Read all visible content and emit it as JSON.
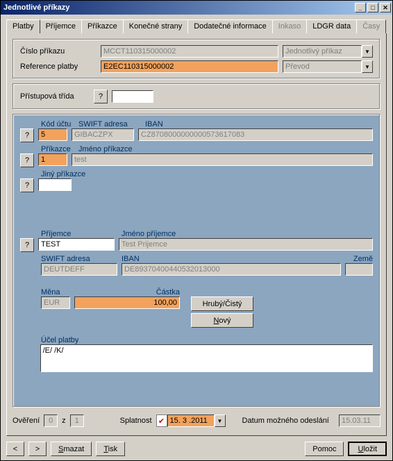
{
  "window": {
    "title": "Jednotlivé příkazy"
  },
  "tabs": {
    "platby": "Platby",
    "prijemce": "Příjemce",
    "prikazce": "Příkazce",
    "konecne": "Konečné strany",
    "dodatecne": "Dodatečné informace",
    "inkaso": "Inkaso",
    "ldgr": "LDGR data",
    "casy": "Časy"
  },
  "head": {
    "cislo_label": "Číslo příkazu",
    "cislo_value": "MCCT110315000002",
    "typ_value": "Jednotlivý příkaz",
    "ref_label": "Reference platby",
    "ref_value": "E2EC110315000002",
    "prevod_value": "Převod"
  },
  "access": {
    "label": "Přístupová třída",
    "value": ""
  },
  "blue": {
    "kod_uctu_label": "Kód účtu",
    "kod_uctu_value": "5",
    "swift1_label": "SWIFT adresa",
    "swift1_value": "GIBACZPX",
    "iban1_label": "IBAN",
    "iban1_value": "CZ8708000000000573617083",
    "prikazce_label": "Příkazce",
    "prikazce_value": "1",
    "jmeno_prikazce_label": "Jméno příkazce",
    "jmeno_prikazce_value": "test",
    "jiny_prikazce_label": "Jiný příkazce",
    "jiny_prikazce_value": "",
    "prijemce_label": "Příjemce",
    "prijemce_value": "TEST",
    "jmeno_prijemce_label": "Jméno příjemce",
    "jmeno_prijemce_value": "Test Prijemce",
    "swift2_label": "SWIFT adresa",
    "swift2_value": "DEUTDEFF",
    "iban2_label": "IBAN",
    "iban2_value": "DE89370400440532013000",
    "zeme_label": "Země",
    "zeme_value": "",
    "mena_label": "Měna",
    "mena_value": "EUR",
    "castka_label": "Částka",
    "castka_value": "100,00",
    "hruby_btn": "Hrubý/Čistý",
    "novy_btn": "Nový",
    "ucel_label": "Účel platby",
    "ucel_value": "/E/ /K/"
  },
  "footer": {
    "overeni_label": "Ověření",
    "overeni_a": "0",
    "overeni_z": "z",
    "overeni_b": "1",
    "splatnost_label": "Splatnost",
    "splatnost_value": "15. 3 .2011",
    "datum_label": "Datum možného odeslání",
    "datum_value": "15.03.11",
    "prev": "<",
    "next": ">",
    "smazat": "Smazat",
    "tisk": "Tisk",
    "pomoc": "Pomoc",
    "ulozit": "Uložit"
  }
}
